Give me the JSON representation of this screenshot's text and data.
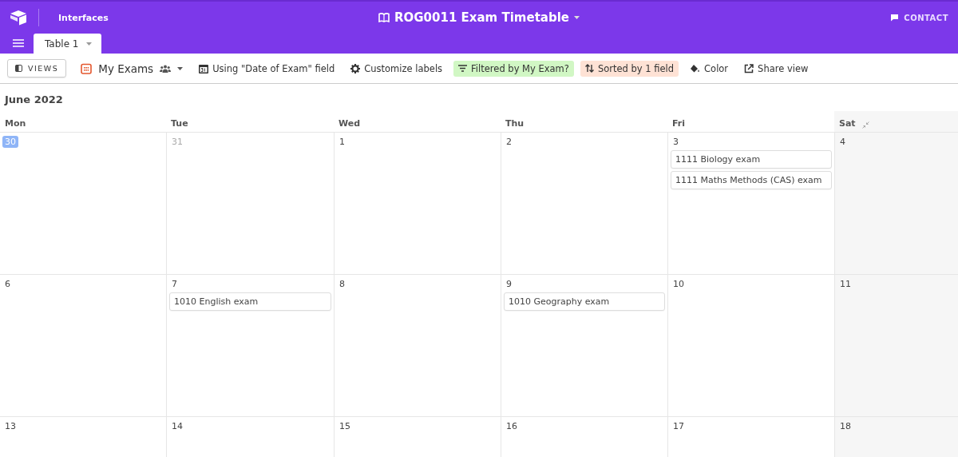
{
  "header": {
    "section": "Interfaces",
    "title": "ROG0011 Exam Timetable",
    "contact": "CONTACT"
  },
  "tabs": [
    {
      "label": "Table 1",
      "selected": true
    }
  ],
  "toolbar": [
    {
      "label": "VIEWS",
      "kind": "views"
    },
    {
      "label": "My Exams",
      "kind": "view-name"
    },
    {
      "label": "Using \"Date of Exam\" field",
      "kind": "plain"
    },
    {
      "label": "Customize labels",
      "kind": "plain"
    },
    {
      "label": "Filtered by My Exam?",
      "kind": "filter"
    },
    {
      "label": "Sorted by 1 field",
      "kind": "sort"
    },
    {
      "label": "Color",
      "kind": "plain"
    },
    {
      "label": "Share view",
      "kind": "plain"
    }
  ],
  "calendar": {
    "month": "June 2022",
    "columns": [
      {
        "label": "Mon",
        "weekend": false
      },
      {
        "label": "Tue",
        "weekend": false
      },
      {
        "label": "Wed",
        "weekend": false
      },
      {
        "label": "Thu",
        "weekend": false
      },
      {
        "label": "Fri",
        "weekend": false
      },
      {
        "label": "Sat",
        "weekend": true
      }
    ],
    "weeks": [
      [
        {
          "day": "30",
          "today": true,
          "outside_month": true
        },
        {
          "day": "31",
          "today": false,
          "outside_month": true
        },
        {
          "day": "1",
          "today": false,
          "outside_month": false
        },
        {
          "day": "2",
          "today": false,
          "outside_month": false
        },
        {
          "day": "3",
          "today": false,
          "outside_month": false,
          "events": [
            "1111 Biology exam",
            "1111 Maths Methods (CAS) exam"
          ]
        },
        {
          "day": "4",
          "today": false,
          "outside_month": false
        }
      ],
      [
        {
          "day": "6",
          "today": false,
          "outside_month": false
        },
        {
          "day": "7",
          "today": false,
          "outside_month": false,
          "events": [
            "1010 English exam"
          ]
        },
        {
          "day": "8",
          "today": false,
          "outside_month": false
        },
        {
          "day": "9",
          "today": false,
          "outside_month": false,
          "events": [
            "1010 Geography exam"
          ]
        },
        {
          "day": "10",
          "today": false,
          "outside_month": false
        },
        {
          "day": "11",
          "today": false,
          "outside_month": false
        }
      ],
      [
        {
          "day": "13",
          "today": false,
          "outside_month": false
        },
        {
          "day": "14",
          "today": false,
          "outside_month": false
        },
        {
          "day": "15",
          "today": false,
          "outside_month": false
        },
        {
          "day": "16",
          "today": false,
          "outside_month": false
        },
        {
          "day": "17",
          "today": false,
          "outside_month": false
        },
        {
          "day": "18",
          "today": false,
          "outside_month": false
        }
      ]
    ]
  }
}
